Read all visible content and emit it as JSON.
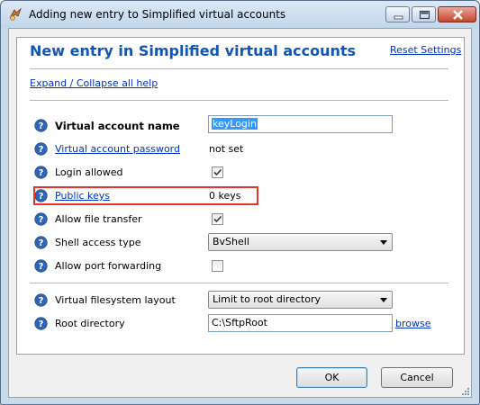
{
  "window": {
    "title": "Adding new entry to Simplified virtual accounts",
    "icon": "bitvise-app-icon"
  },
  "header": {
    "title": "New entry in Simplified virtual accounts",
    "reset_label": "Reset Settings",
    "expand_label": "Expand / Collapse all help"
  },
  "fields": {
    "virtual_account_name": {
      "label": "Virtual account name",
      "value": "keyLogin"
    },
    "virtual_account_password": {
      "label": "Virtual account password",
      "value": "not set"
    },
    "login_allowed": {
      "label": "Login allowed",
      "checked": true
    },
    "public_keys": {
      "label": "Public keys",
      "value": "0 keys"
    },
    "allow_file_transfer": {
      "label": "Allow file transfer",
      "checked": true
    },
    "shell_access_type": {
      "label": "Shell access type",
      "value": "BvShell"
    },
    "allow_port_forwarding": {
      "label": "Allow port forwarding",
      "checked": false
    },
    "virtual_filesystem_layout": {
      "label": "Virtual filesystem layout",
      "value": "Limit to root directory"
    },
    "root_directory": {
      "label": "Root directory",
      "value": "C:\\SftpRoot",
      "browse_label": "browse"
    }
  },
  "buttons": {
    "ok": "OK",
    "cancel": "Cancel"
  },
  "colors": {
    "header_title": "#1255b8",
    "link": "#0033cc",
    "highlight": "#e8322b",
    "help_icon": "#2b64b8"
  }
}
